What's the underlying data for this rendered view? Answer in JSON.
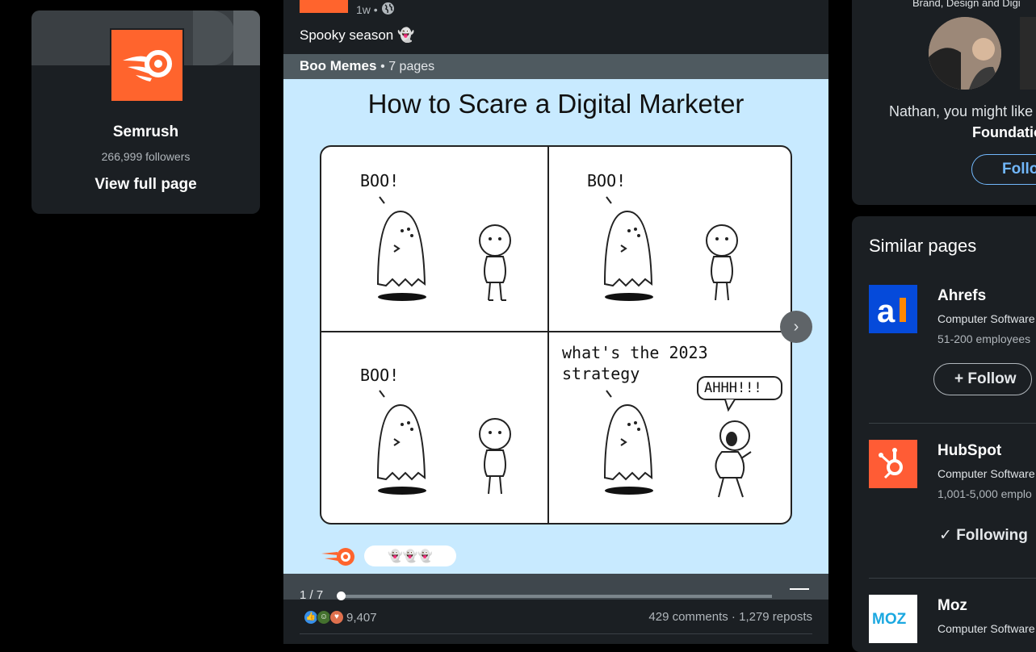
{
  "company": {
    "name": "Semrush",
    "followers": "266,999 followers",
    "view_full_page": "View full page"
  },
  "post": {
    "time": "1w •",
    "caption": "Spooky season 👻",
    "document_title": "Boo Memes",
    "document_pages": "• 7 pages",
    "comic_title": "How to Scare a Digital Marketer",
    "panel1_text": "BOO!",
    "panel2_text": "BOO!",
    "panel3_text": "BOO!",
    "panel4_text_line1": "what's the 2023",
    "panel4_text_line2": "strategy",
    "panel4_scream": "AHHH!!!",
    "footer_emojis": "👻👻👻",
    "page_indicator": "1 / 7",
    "reaction_count": "9,407",
    "comments_reposts": "429 comments · 1,279 reposts"
  },
  "suggestion": {
    "topline": "Brand, Design and Digi",
    "text": "Nathan, you might like",
    "text_bold": "Foundatio",
    "follow_label": "Follow"
  },
  "similar": {
    "heading": "Similar pages",
    "items": [
      {
        "name": "Ahrefs",
        "industry": "Computer Software",
        "employees": "51-200 employees",
        "action": "Follow",
        "color": "#054ada"
      },
      {
        "name": "HubSpot",
        "industry": "Computer Software",
        "employees": "1,001-5,000 emplo",
        "action": "Following",
        "color": "#ff5c35"
      },
      {
        "name": "Moz",
        "industry": "Computer Software",
        "employees": "",
        "action": "",
        "color": "#ffffff"
      }
    ]
  },
  "colors": {
    "semrush_orange": "#ff642d",
    "link_blue": "#71b7fb",
    "slide_bg": "#c8eaff"
  }
}
